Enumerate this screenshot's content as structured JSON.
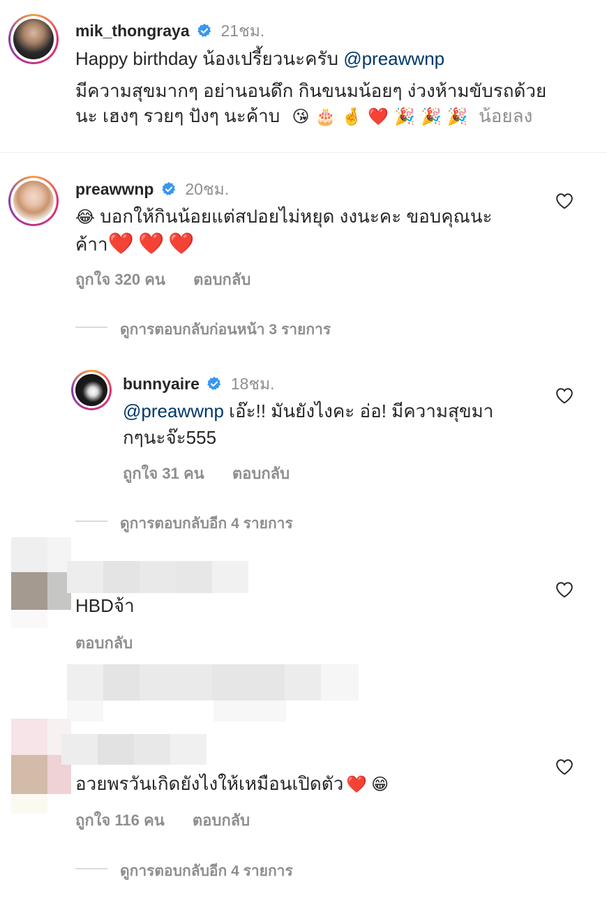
{
  "post": {
    "username": "mik_thongraya",
    "time": "21ชม.",
    "line1_text": "Happy birthday น้องเปรี้ยวนะครับ ",
    "line1_mention": "@preawwnp",
    "line2": "มีความสุขมากๆ อย่านอนดึก กินขนมน้อยๆ ง่วงห้ามขับรถด้วย",
    "line3_text": "นะ เฮงๆ รวยๆ ปังๆ นะค้าบ",
    "line3_emojis": "😘🎂🤞❤️🎉🎉🎉",
    "see_less": "น้อยลง"
  },
  "comments": [
    {
      "username": "preawwnp",
      "time": "20ชม.",
      "emoji_prefix": "😂",
      "line1": " บอกให้กินน้อยแต่สปอยไม่หยุด งงนะคะ ขอบคุณนะ",
      "line2_text": "ค้าา",
      "line2_emojis": "❤️❤️❤️",
      "likes": "ถูกใจ 320 คน",
      "reply": "ตอบกลับ",
      "view_replies": "ดูการตอบกลับก่อนหน้า 3 รายการ"
    },
    {
      "username": "bunnyaire",
      "time": "18ชม.",
      "mention": "@preawwnp",
      "line1": " เอ๊ะ!! มันยังไงคะ อ่อ! มีความสุขมา",
      "line2": "กๆนะจ๊ะ555",
      "likes": "ถูกใจ 31 คน",
      "reply": "ตอบกลับ",
      "view_replies": "ดูการตอบกลับอีก 4 รายการ"
    },
    {
      "text": "HBDจ้า",
      "reply": "ตอบกลับ"
    },
    {
      "text": "อวยพรวันเกิดยังไงให้เหมือนเปิดตัว",
      "emojis": "❤️😁",
      "likes": "ถูกใจ 116 คน",
      "reply": "ตอบกลับ",
      "view_replies": "ดูการตอบกลับอีก 4 รายการ"
    }
  ],
  "colors": {
    "verified": "#3897f0",
    "mention": "#00376b",
    "secondary": "#8e8e8e"
  }
}
